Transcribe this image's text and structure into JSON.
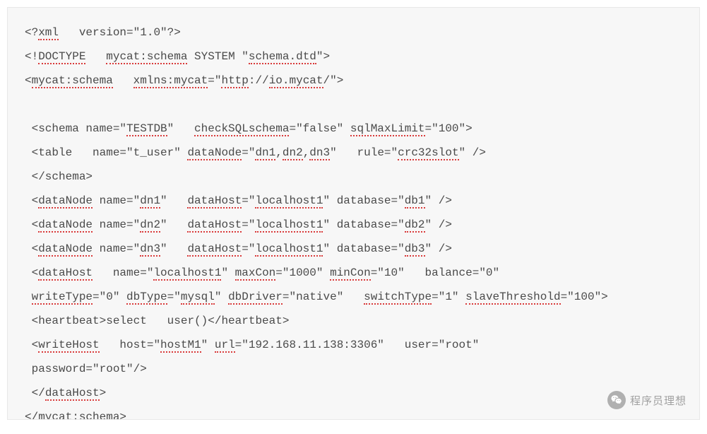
{
  "code": {
    "lines": [
      [
        {
          "t": "<?"
        },
        {
          "t": "xml",
          "u": 1
        },
        {
          "t": "   version=\"1.0\"?>"
        }
      ],
      [
        {
          "t": "<!"
        },
        {
          "t": "DOCTYPE",
          "u": 1
        },
        {
          "t": "   "
        },
        {
          "t": "mycat:schema",
          "u": 1
        },
        {
          "t": " SYSTEM \""
        },
        {
          "t": "schema.dtd",
          "u": 1
        },
        {
          "t": "\">"
        }
      ],
      [
        {
          "t": "<"
        },
        {
          "t": "mycat:schema",
          "u": 1
        },
        {
          "t": "   "
        },
        {
          "t": "xmlns:mycat",
          "u": 1
        },
        {
          "t": "=\""
        },
        {
          "t": "http",
          "u": 1
        },
        {
          "t": "://"
        },
        {
          "t": "io.mycat",
          "u": 1
        },
        {
          "t": "/\">"
        }
      ],
      [
        {
          "t": ""
        }
      ],
      [
        {
          "t": " <schema name=\""
        },
        {
          "t": "TESTDB",
          "u": 1
        },
        {
          "t": "\"   "
        },
        {
          "t": "checkSQLschema",
          "u": 1
        },
        {
          "t": "=\"false\" "
        },
        {
          "t": "sqlMaxLimit",
          "u": 1
        },
        {
          "t": "=\"100\">"
        }
      ],
      [
        {
          "t": " <table   name=\"t_user\" "
        },
        {
          "t": "dataNode",
          "u": 1
        },
        {
          "t": "=\""
        },
        {
          "t": "dn1",
          "u": 1
        },
        {
          "t": ","
        },
        {
          "t": "dn2",
          "u": 1
        },
        {
          "t": ","
        },
        {
          "t": "dn3",
          "u": 1
        },
        {
          "t": "\"   rule=\""
        },
        {
          "t": "crc32slot",
          "u": 1
        },
        {
          "t": "\" />"
        }
      ],
      [
        {
          "t": " </schema>"
        }
      ],
      [
        {
          "t": " <"
        },
        {
          "t": "dataNode",
          "u": 1
        },
        {
          "t": " name=\""
        },
        {
          "t": "dn1",
          "u": 1
        },
        {
          "t": "\"   "
        },
        {
          "t": "dataHost",
          "u": 1
        },
        {
          "t": "=\""
        },
        {
          "t": "localhost1",
          "u": 1
        },
        {
          "t": "\" database=\""
        },
        {
          "t": "db1",
          "u": 1
        },
        {
          "t": "\" />"
        }
      ],
      [
        {
          "t": " <"
        },
        {
          "t": "dataNode",
          "u": 1
        },
        {
          "t": " name=\""
        },
        {
          "t": "dn2",
          "u": 1
        },
        {
          "t": "\"   "
        },
        {
          "t": "dataHost",
          "u": 1
        },
        {
          "t": "=\""
        },
        {
          "t": "localhost1",
          "u": 1
        },
        {
          "t": "\" database=\""
        },
        {
          "t": "db2",
          "u": 1
        },
        {
          "t": "\" />"
        }
      ],
      [
        {
          "t": " <"
        },
        {
          "t": "dataNode",
          "u": 1
        },
        {
          "t": " name=\""
        },
        {
          "t": "dn3",
          "u": 1
        },
        {
          "t": "\"   "
        },
        {
          "t": "dataHost",
          "u": 1
        },
        {
          "t": "=\""
        },
        {
          "t": "localhost1",
          "u": 1
        },
        {
          "t": "\" database=\""
        },
        {
          "t": "db3",
          "u": 1
        },
        {
          "t": "\" />"
        }
      ],
      [
        {
          "t": " <"
        },
        {
          "t": "dataHost",
          "u": 1
        },
        {
          "t": "   name=\""
        },
        {
          "t": "localhost1",
          "u": 1
        },
        {
          "t": "\" "
        },
        {
          "t": "maxCon",
          "u": 1
        },
        {
          "t": "=\"1000\" "
        },
        {
          "t": "minCon",
          "u": 1
        },
        {
          "t": "=\"10\"   balance=\"0\""
        }
      ],
      [
        {
          "t": " "
        },
        {
          "t": "writeType",
          "u": 1
        },
        {
          "t": "=\"0\" "
        },
        {
          "t": "dbType",
          "u": 1
        },
        {
          "t": "=\""
        },
        {
          "t": "mysql",
          "u": 1
        },
        {
          "t": "\" "
        },
        {
          "t": "dbDriver",
          "u": 1
        },
        {
          "t": "=\"native\"   "
        },
        {
          "t": "switchType",
          "u": 1
        },
        {
          "t": "=\"1\" "
        },
        {
          "t": "slaveThreshold",
          "u": 1
        },
        {
          "t": "=\"100\">"
        }
      ],
      [
        {
          "t": " <heartbeat>select   user()</heartbeat>"
        }
      ],
      [
        {
          "t": " <"
        },
        {
          "t": "writeHost",
          "u": 1
        },
        {
          "t": "   host=\""
        },
        {
          "t": "hostM1",
          "u": 1
        },
        {
          "t": "\" "
        },
        {
          "t": "url",
          "u": 1
        },
        {
          "t": "=\"192.168.11.138:3306\"   user=\"root\""
        }
      ],
      [
        {
          "t": " password=\"root\"/>"
        }
      ],
      [
        {
          "t": " </"
        },
        {
          "t": "dataHost",
          "u": 1
        },
        {
          "t": ">"
        }
      ],
      [
        {
          "t": "</"
        },
        {
          "t": "mycat:schema",
          "u": 1
        },
        {
          "t": ">"
        }
      ]
    ]
  },
  "watermark": {
    "text": "程序员理想"
  }
}
